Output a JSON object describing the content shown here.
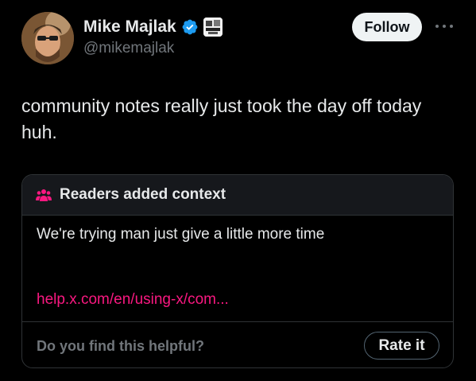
{
  "author": {
    "display_name": "Mike Majlak",
    "handle": "@mikemajlak",
    "verified": true,
    "avatar_icon": "user-avatar"
  },
  "actions": {
    "follow_label": "Follow",
    "more_icon": "more-horizontal-icon"
  },
  "tweet": {
    "text": "community notes really just took the day off today huh."
  },
  "community_note": {
    "header_icon": "people-icon",
    "title": "Readers added context",
    "body": "We're trying man just give a little more time",
    "link_text": "help.x.com/en/using-x/com...",
    "helpful_prompt": "Do you find this helpful?",
    "rate_label": "Rate it"
  },
  "colors": {
    "background": "#000000",
    "text": "#e7e9ea",
    "muted": "#71767b",
    "verified_blue": "#1d9bf0",
    "note_accent": "#f91880",
    "border": "#2f3336"
  }
}
